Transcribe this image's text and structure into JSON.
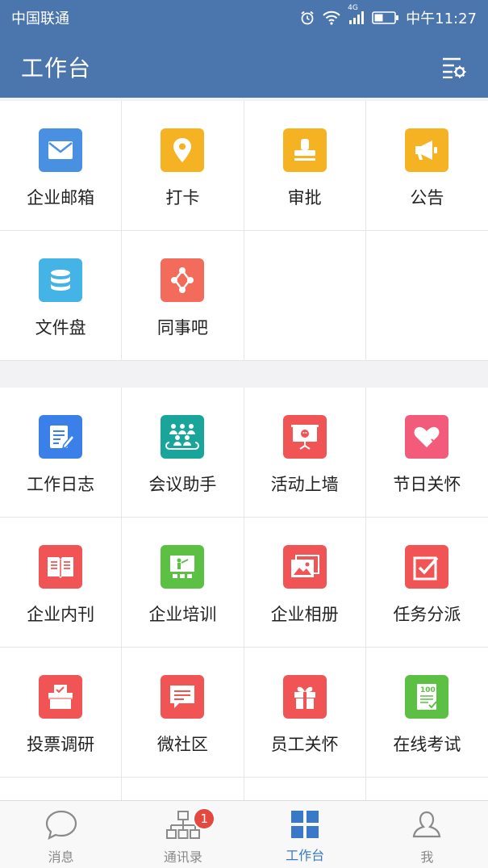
{
  "status_bar": {
    "carrier": "中国联通",
    "network": "4G",
    "time": "中午11:27"
  },
  "header": {
    "title": "工作台"
  },
  "section1": [
    {
      "label": "企业邮箱",
      "icon": "mail-icon",
      "color": "#4a90e2"
    },
    {
      "label": "打卡",
      "icon": "location-pin-icon",
      "color": "#f5b223"
    },
    {
      "label": "审批",
      "icon": "stamp-icon",
      "color": "#f5b223"
    },
    {
      "label": "公告",
      "icon": "megaphone-icon",
      "color": "#f5b223"
    },
    {
      "label": "文件盘",
      "icon": "database-icon",
      "color": "#44b3e6"
    },
    {
      "label": "同事吧",
      "icon": "network-icon",
      "color": "#f26b5b"
    }
  ],
  "section2": [
    {
      "label": "工作日志",
      "icon": "journal-icon",
      "color": "#3b80e8"
    },
    {
      "label": "会议助手",
      "icon": "meeting-icon",
      "color": "#1aa59a"
    },
    {
      "label": "活动上墙",
      "icon": "projector-icon",
      "color": "#f05454"
    },
    {
      "label": "节日关怀",
      "icon": "heart-tag-icon",
      "color": "#f25c7a"
    },
    {
      "label": "企业内刊",
      "icon": "magazine-icon",
      "color": "#f05454"
    },
    {
      "label": "企业培训",
      "icon": "training-icon",
      "color": "#5cc045"
    },
    {
      "label": "企业相册",
      "icon": "album-icon",
      "color": "#f05454"
    },
    {
      "label": "任务分派",
      "icon": "checkbox-icon",
      "color": "#f05454"
    },
    {
      "label": "投票调研",
      "icon": "ballot-box-icon",
      "color": "#f05454"
    },
    {
      "label": "微社区",
      "icon": "chat-bubble-icon",
      "color": "#f05454"
    },
    {
      "label": "员工关怀",
      "icon": "gift-icon",
      "color": "#f05454"
    },
    {
      "label": "在线考试",
      "icon": "exam-paper-icon",
      "color": "#5cc045"
    }
  ],
  "tabs": [
    {
      "label": "消息",
      "icon": "message-icon"
    },
    {
      "label": "通讯录",
      "icon": "org-chart-icon",
      "badge": "1"
    },
    {
      "label": "工作台",
      "icon": "grid-icon",
      "active": true
    },
    {
      "label": "我",
      "icon": "user-icon"
    }
  ],
  "colors": {
    "primary": "#4a76ad",
    "active_tab": "#3a78c8",
    "badge": "#e4483f"
  }
}
